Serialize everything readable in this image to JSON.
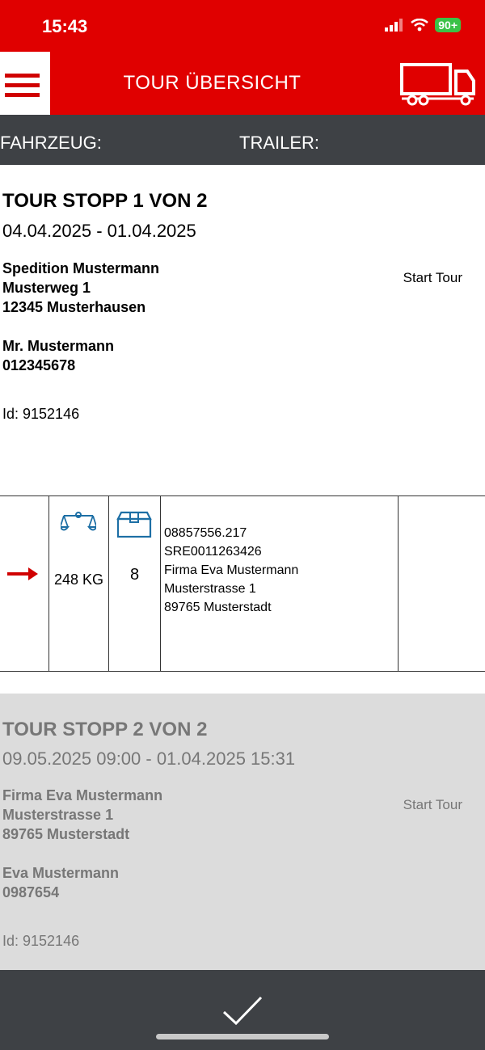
{
  "status_bar": {
    "time": "15:43",
    "battery": "90+",
    "icons": [
      "signal-icon",
      "wifi-icon",
      "battery-icon"
    ]
  },
  "header": {
    "title": "TOUR ÜBERSICHT",
    "menu_icon": "hamburger-menu-icon",
    "truck_icon": "truck-icon"
  },
  "subheader": {
    "vehicle_label": "FAHRZEUG:",
    "trailer_label": "TRAILER:"
  },
  "stops": [
    {
      "title": "TOUR STOPP 1 VON 2",
      "date": "04.04.2025 - 01.04.2025",
      "address": [
        "Spedition Mustermann",
        "Musterweg 1",
        "12345 Musterhausen"
      ],
      "contact": [
        "Mr. Mustermann",
        "012345678"
      ],
      "id": "Id: 9152146",
      "action": "Start Tour",
      "items": [
        {
          "weight": "248 KG",
          "count": "8",
          "info": [
            "08857556.217",
            "SRE0011263426",
            "Firma Eva Mustermann",
            "Musterstrasse 1",
            "89765 Musterstadt"
          ]
        }
      ]
    },
    {
      "title": "TOUR STOPP 2 VON 2",
      "date": "09.05.2025 09:00 - 01.04.2025 15:31",
      "address": [
        "Firma Eva Mustermann",
        "Musterstrasse 1",
        "89765 Musterstadt"
      ],
      "contact": [
        "Eva Mustermann",
        "0987654"
      ],
      "id": "Id: 9152146",
      "action": "Start Tour"
    }
  ],
  "colors": {
    "brand_red": "#e00000",
    "dark_bar": "#3e4145",
    "icon_blue": "#1d6fa5",
    "inactive_bg": "#dcdcdc"
  }
}
